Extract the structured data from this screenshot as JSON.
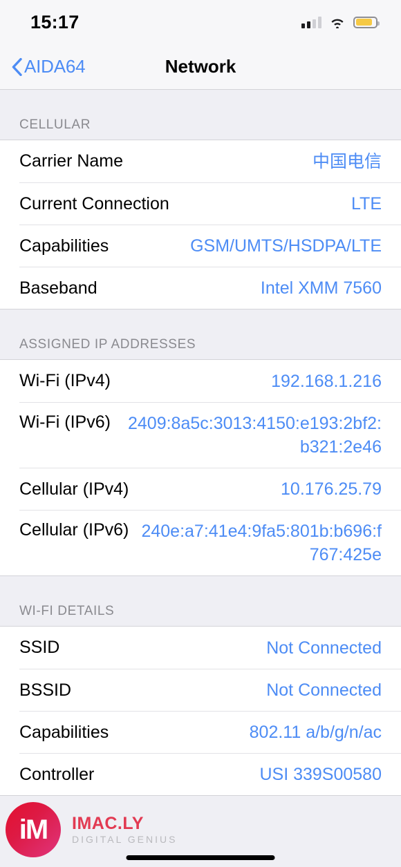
{
  "status_bar": {
    "time": "15:17",
    "signal_icon": "cellular-signal-icon",
    "signal_bars_filled": 2,
    "signal_bars_total": 4,
    "wifi_icon": "wifi-icon",
    "battery_icon": "battery-icon",
    "battery_color": "#f6c945",
    "battery_level_percent": 85
  },
  "nav_bar": {
    "back_icon": "chevron-left-icon",
    "back_label": "AIDA64",
    "title": "Network"
  },
  "theme": {
    "accent_blue": "#4d8cf5",
    "background_gray": "#efeff4",
    "row_background": "#ffffff",
    "header_text": "#8a8a8f"
  },
  "sections": [
    {
      "header": "CELLULAR",
      "rows": [
        {
          "label": "Carrier Name",
          "value": "中国电信",
          "multiline": false
        },
        {
          "label": "Current Connection",
          "value": "LTE",
          "multiline": false
        },
        {
          "label": "Capabilities",
          "value": "GSM/UMTS/HSDPA/LTE",
          "multiline": false
        },
        {
          "label": "Baseband",
          "value": "Intel XMM 7560",
          "multiline": false
        }
      ]
    },
    {
      "header": "ASSIGNED IP ADDRESSES",
      "rows": [
        {
          "label": "Wi-Fi (IPv4)",
          "value": "192.168.1.216",
          "multiline": false
        },
        {
          "label": "Wi-Fi (IPv6)",
          "value": "2409:8a5c:3013:4150:e193:2bf2:b321:2e46",
          "multiline": true
        },
        {
          "label": "Cellular (IPv4)",
          "value": "10.176.25.79",
          "multiline": false
        },
        {
          "label": "Cellular (IPv6)",
          "value": "240e:a7:41e4:9fa5:801b:b696:f767:425e",
          "multiline": true
        }
      ]
    },
    {
      "header": "WI-FI DETAILS",
      "rows": [
        {
          "label": "SSID",
          "value": "Not Connected",
          "multiline": false
        },
        {
          "label": "BSSID",
          "value": "Not Connected",
          "multiline": false
        },
        {
          "label": "Capabilities",
          "value": "802.11 a/b/g/n/ac",
          "multiline": false
        },
        {
          "label": "Controller",
          "value": "USI 339S00580",
          "multiline": false
        }
      ]
    }
  ],
  "watermark": {
    "monogram": "iM",
    "title": "IMAC.LY",
    "subtitle": "DIGITAL GENIUS",
    "brand_color": "#e23a52"
  }
}
